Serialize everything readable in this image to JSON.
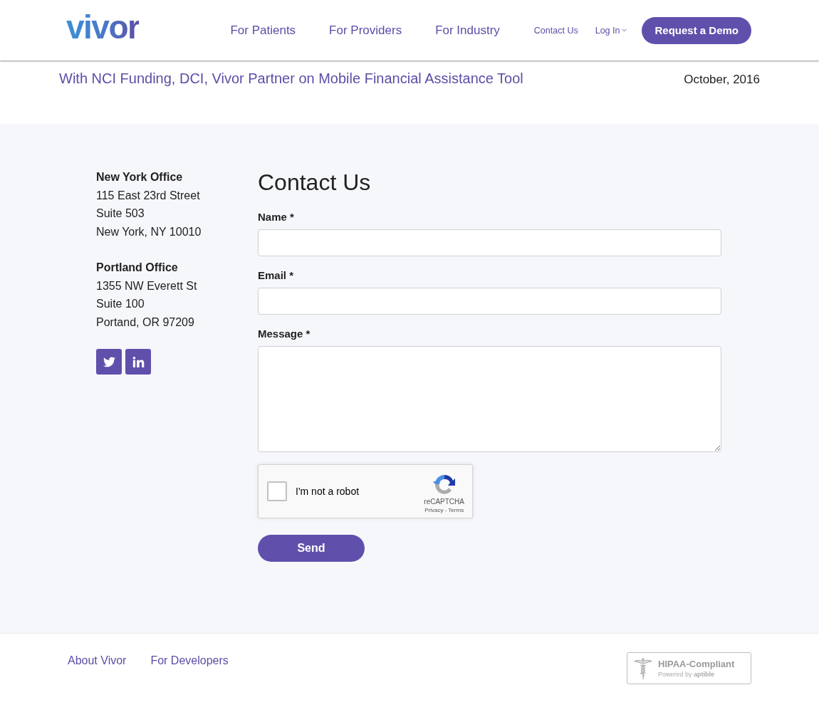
{
  "header": {
    "logo": "vivor",
    "nav": [
      {
        "label": "For Patients"
      },
      {
        "label": "For Providers"
      },
      {
        "label": "For Industry"
      }
    ],
    "utility_links": [
      {
        "label": "Contact Us",
        "kind": "link"
      },
      {
        "label": "Log In",
        "kind": "dropdown"
      }
    ],
    "cta": "Request a Demo"
  },
  "press": {
    "items": [
      {
        "title": "With NCI Funding, DCI, Vivor Partner on Mobile Financial Assistance Tool",
        "date": "October, 2016"
      }
    ]
  },
  "offices": [
    {
      "name": "New York Office",
      "lines": [
        "115 East 23rd Street",
        "Suite 503",
        "New York, NY 10010"
      ]
    },
    {
      "name": "Portland Office",
      "lines": [
        "1355 NW Everett St",
        "Suite 100",
        "Portand, OR 97209"
      ]
    }
  ],
  "social_links": [
    {
      "kind": "twitter"
    },
    {
      "kind": "linkedin"
    }
  ],
  "contact_form": {
    "title": "Contact Us",
    "fields": [
      {
        "label": "Name *",
        "kind": "text"
      },
      {
        "label": "Email *",
        "kind": "text"
      },
      {
        "label": "Message *",
        "kind": "textarea"
      }
    ],
    "captcha": {
      "label": "I'm not a robot",
      "checked": false,
      "brand": "reCAPTCHA",
      "links": "Privacy - Terms"
    },
    "submit": "Send"
  },
  "footer": {
    "links": [
      "About Vivor",
      "For Developers"
    ],
    "badge": {
      "title": "HIPAA-Compliant",
      "subtitle": "Powered by **aptible**"
    }
  }
}
